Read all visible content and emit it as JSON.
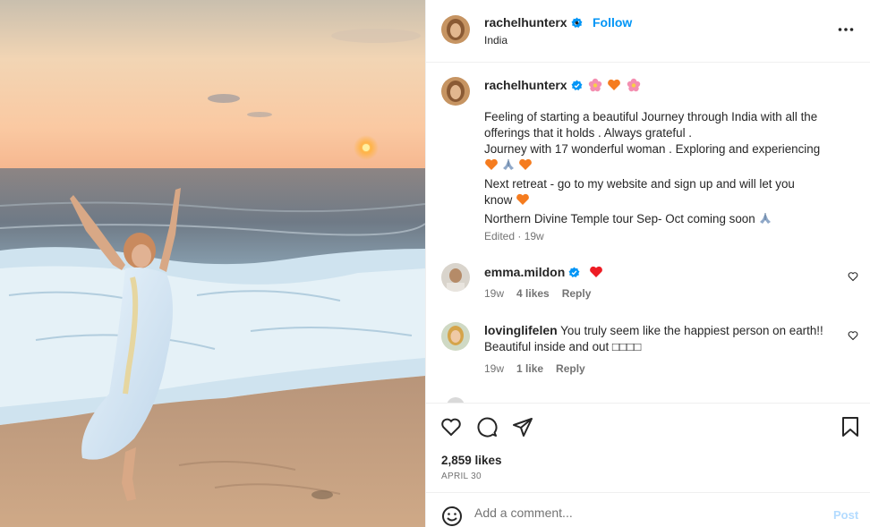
{
  "post": {
    "username": "rachelhunterx",
    "follow_label": "Follow",
    "location": "India",
    "separator": "•"
  },
  "caption": {
    "username": "rachelhunterx",
    "lines": [
      "Feeling of starting a beautiful Journey through India with all the",
      "offerings that it holds . Always grateful .",
      "Journey with 17 wonderful woman . Exploring and experiencing",
      "Next retreat - go to my website and sign up and will let you",
      "know",
      "Northern Divine Temple tour Sep- Oct coming soon"
    ],
    "edited_label": "Edited",
    "time": "19w"
  },
  "comments": [
    {
      "username": "emma.mildon",
      "text": "",
      "time": "19w",
      "likes": "4 likes",
      "reply_label": "Reply"
    },
    {
      "username": "lovinglifelen",
      "text": "You truly seem like the happiest person on earth!!",
      "text2": "Beautiful inside and out □□□□",
      "time": "19w",
      "likes": "1 like",
      "reply_label": "Reply"
    }
  ],
  "stats": {
    "likes": "2,859 likes",
    "date": "APRIL 30"
  },
  "add_comment": {
    "placeholder": "Add a comment...",
    "post_label": "Post"
  },
  "icons": {
    "verified": "verified-badge-icon",
    "more": "more-options-icon",
    "like": "heart-icon",
    "comment": "comment-icon",
    "share": "send-icon",
    "save": "bookmark-icon",
    "emoji": "emoji-smile-icon"
  },
  "colors": {
    "accent": "#0095f6",
    "post_disabled": "#b3dbff",
    "heart_red": "#ed1c24",
    "heart_orange": "#f57c1f",
    "muted": "#737373"
  }
}
